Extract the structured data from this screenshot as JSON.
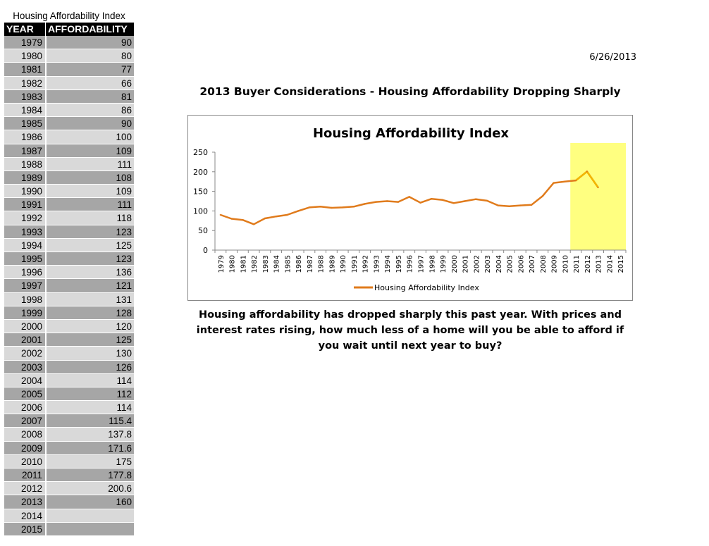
{
  "table": {
    "title": "Housing Affordability Index",
    "headers": [
      "YEAR",
      "AFFORDABILITY"
    ],
    "rows": [
      [
        "1979",
        "90"
      ],
      [
        "1980",
        "80"
      ],
      [
        "1981",
        "77"
      ],
      [
        "1982",
        "66"
      ],
      [
        "1983",
        "81"
      ],
      [
        "1984",
        "86"
      ],
      [
        "1985",
        "90"
      ],
      [
        "1986",
        "100"
      ],
      [
        "1987",
        "109"
      ],
      [
        "1988",
        "111"
      ],
      [
        "1989",
        "108"
      ],
      [
        "1990",
        "109"
      ],
      [
        "1991",
        "111"
      ],
      [
        "1992",
        "118"
      ],
      [
        "1993",
        "123"
      ],
      [
        "1994",
        "125"
      ],
      [
        "1995",
        "123"
      ],
      [
        "1996",
        "136"
      ],
      [
        "1997",
        "121"
      ],
      [
        "1998",
        "131"
      ],
      [
        "1999",
        "128"
      ],
      [
        "2000",
        "120"
      ],
      [
        "2001",
        "125"
      ],
      [
        "2002",
        "130"
      ],
      [
        "2003",
        "126"
      ],
      [
        "2004",
        "114"
      ],
      [
        "2005",
        "112"
      ],
      [
        "2006",
        "114"
      ],
      [
        "2007",
        "115.4"
      ],
      [
        "2008",
        "137.8"
      ],
      [
        "2009",
        "171.6"
      ],
      [
        "2010",
        "175"
      ],
      [
        "2011",
        "177.8"
      ],
      [
        "2012",
        "200.6"
      ],
      [
        "2013",
        "160"
      ],
      [
        "2014",
        ""
      ],
      [
        "2015",
        ""
      ]
    ]
  },
  "date": "6/26/2013",
  "headline": "2013 Buyer Considerations - Housing Affordability Dropping Sharply",
  "caption": "Housing affordability has dropped sharply this past year. With prices and interest rates rising, how much less of a home will you be able to afford if you wait until next year to buy?",
  "colors": {
    "line": "#e07b1c",
    "highlight_line": "#f2b600",
    "highlight_band": "#ffff80",
    "row_dark": "#a6a6a6",
    "row_light": "#d9d9d9"
  },
  "chart_data": {
    "type": "line",
    "title": "Housing Affordability Index",
    "categories": [
      "1979",
      "1980",
      "1981",
      "1982",
      "1983",
      "1984",
      "1985",
      "1986",
      "1987",
      "1988",
      "1989",
      "1990",
      "1991",
      "1992",
      "1993",
      "1994",
      "1995",
      "1996",
      "1997",
      "1998",
      "1999",
      "2000",
      "2001",
      "2002",
      "2003",
      "2004",
      "2005",
      "2006",
      "2007",
      "2008",
      "2009",
      "2010",
      "2011",
      "2012",
      "2013",
      "2014",
      "2015"
    ],
    "series": [
      {
        "name": "Housing Affordability Index",
        "values": [
          90,
          80,
          77,
          66,
          81,
          86,
          90,
          100,
          109,
          111,
          108,
          109,
          111,
          118,
          123,
          125,
          123,
          136,
          121,
          131,
          128,
          120,
          125,
          130,
          126,
          114,
          112,
          114,
          115.4,
          137.8,
          171.6,
          175,
          177.8,
          200.6,
          160,
          null,
          null
        ]
      }
    ],
    "ylim": [
      0,
      250
    ],
    "yticks": [
      "0",
      "50",
      "100",
      "150",
      "200",
      "250"
    ],
    "highlight_range": [
      "2011",
      "2015"
    ],
    "legend_position": "bottom",
    "grid": false
  }
}
